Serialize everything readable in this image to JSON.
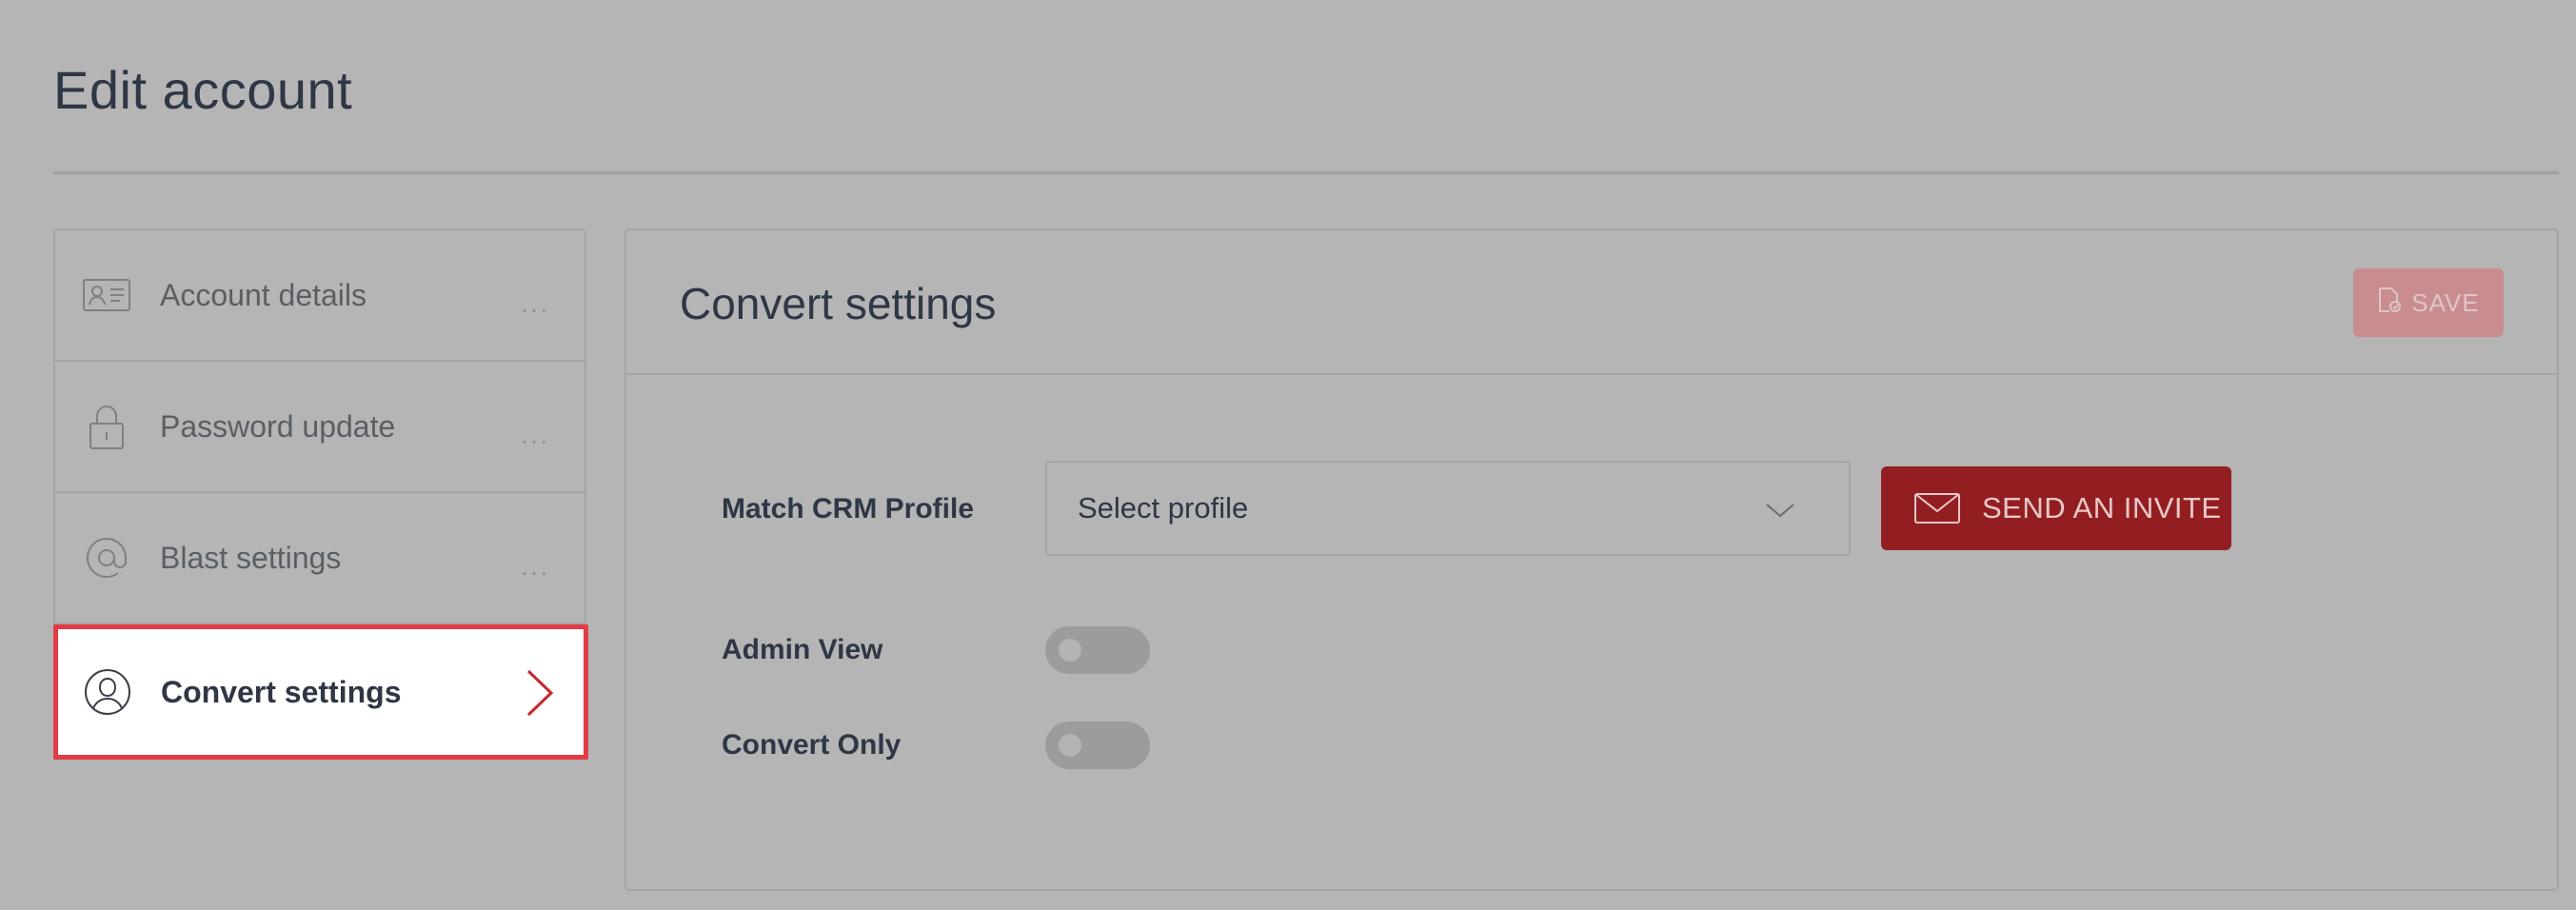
{
  "page": {
    "title": "Edit account"
  },
  "sidebar": {
    "items": [
      {
        "label": "Account details",
        "icon": "id-card-icon",
        "more": "..."
      },
      {
        "label": "Password update",
        "icon": "lock-icon",
        "more": "..."
      },
      {
        "label": "Blast settings",
        "icon": "at-sign-icon",
        "more": "..."
      },
      {
        "label": "Convert settings",
        "icon": "user-icon",
        "active": true
      }
    ]
  },
  "panel": {
    "title": "Convert settings",
    "save_label": "SAVE",
    "match_crm_label": "Match CRM Profile",
    "profile_select": {
      "value": "Select profile"
    },
    "invite_label": "SEND AN INVITE",
    "admin_view_label": "Admin View",
    "convert_only_label": "Convert Only",
    "admin_view_on": false,
    "convert_only_on": false
  },
  "colors": {
    "accent": "#931e22",
    "active_border": "#e33b44",
    "background": "#b4b5b4"
  }
}
